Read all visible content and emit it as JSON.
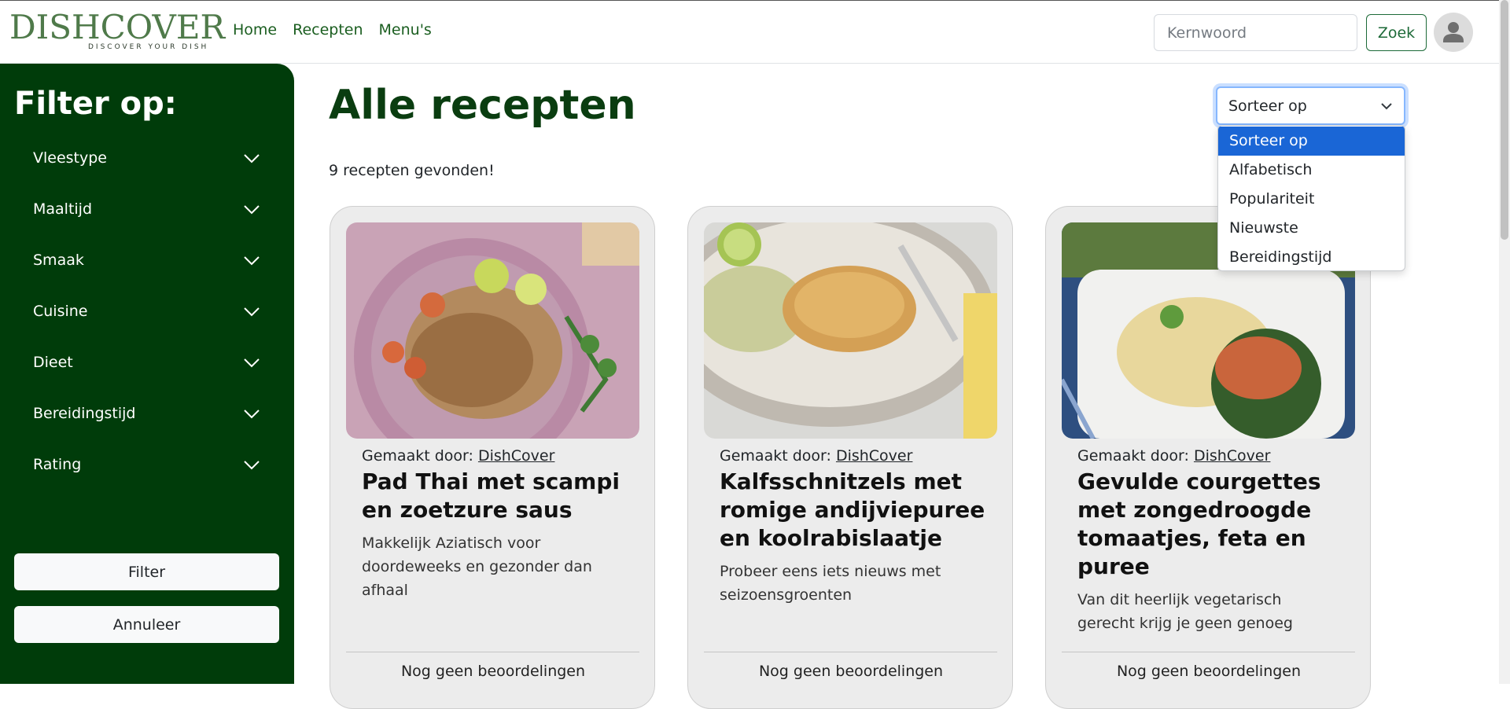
{
  "brand": {
    "name": "DISHCOVER",
    "tagline": "DISCOVER YOUR DISH"
  },
  "nav": {
    "links": [
      "Home",
      "Recepten",
      "Menu's"
    ]
  },
  "search": {
    "placeholder": "Kernwoord",
    "button": "Zoek"
  },
  "sidebar": {
    "title": "Filter op:",
    "filters": [
      "Vleestype",
      "Maaltijd",
      "Smaak",
      "Cuisine",
      "Dieet",
      "Bereidingstijd",
      "Rating"
    ],
    "filter_button": "Filter",
    "cancel_button": "Annuleer"
  },
  "main": {
    "title": "Alle recepten",
    "result_count": "9 recepten gevonden!",
    "sort": {
      "selected": "Sorteer op",
      "options": [
        "Sorteer op",
        "Alfabetisch",
        "Populariteit",
        "Nieuwste",
        "Bereidingstijd"
      ]
    }
  },
  "cards": [
    {
      "author_prefix": "Gemaakt door: ",
      "author": "DishCover",
      "title": "Pad Thai met scampi en zoetzure saus",
      "description": "Makkelijk Aziatisch voor doordeweeks en gezonder dan afhaal",
      "rating": "Nog geen beoordelingen"
    },
    {
      "author_prefix": "Gemaakt door: ",
      "author": "DishCover",
      "title": "Kalfsschnitzels met romige andijviepuree en koolrabislaatje",
      "description": "Probeer eens iets nieuws met seizoensgroenten",
      "rating": "Nog geen beoordelingen"
    },
    {
      "author_prefix": "Gemaakt door: ",
      "author": "DishCover",
      "title": "Gevulde courgettes met zongedroogde tomaatjes, feta en puree",
      "description": "Van dit heerlijk vegetarisch gerecht krijg je geen genoeg",
      "rating": "Nog geen beoordelingen"
    }
  ],
  "colors": {
    "brand_green": "#003c0a",
    "title_green": "#0a3d10",
    "link_green": "#1b5e20",
    "selected_blue": "#1a66d6"
  }
}
